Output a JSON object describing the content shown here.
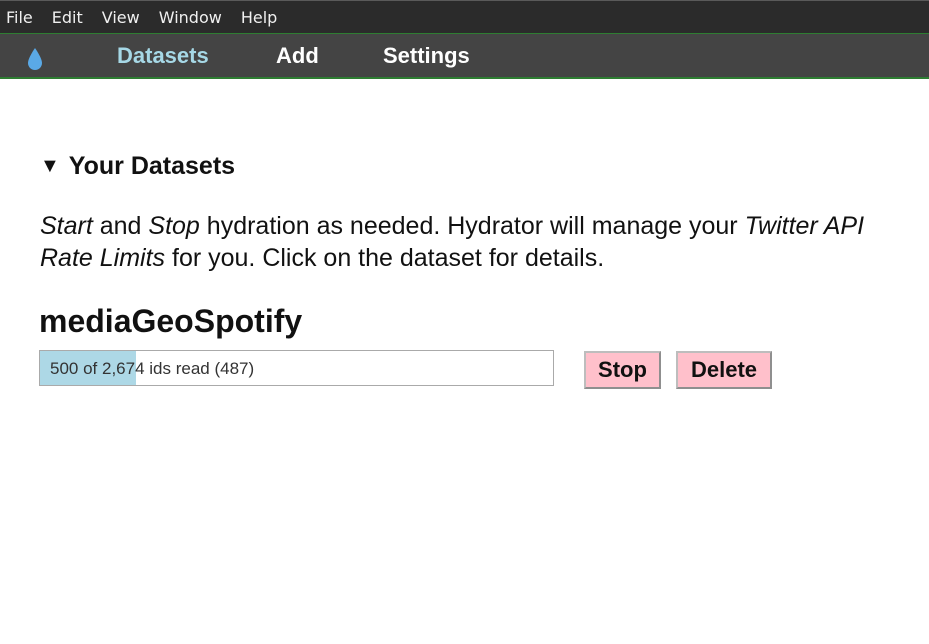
{
  "menubar": {
    "items": [
      "File",
      "Edit",
      "View",
      "Window",
      "Help"
    ]
  },
  "nav": {
    "logo_icon": "water-drop-icon",
    "logo_color": "#5aa9e6",
    "links": [
      {
        "label": "Datasets",
        "active": true
      },
      {
        "label": "Add",
        "active": false
      },
      {
        "label": "Settings",
        "active": false
      }
    ],
    "active_color": "#a6d8e6",
    "accent_border": "#2e7d32"
  },
  "section": {
    "toggle_icon": "▼",
    "title": "Your Datasets"
  },
  "intro": {
    "start": "Start",
    "and": " and ",
    "stop": "Stop",
    "middle": " hydration as needed. Hydrator will manage your ",
    "rate_limits": "Twitter API Rate Limits",
    "end": " for you. Click on the dataset for details."
  },
  "dataset": {
    "name": "mediaGeoSpotify",
    "progress_label": "500 of 2,674 ids read (487)",
    "progress_fraction": 0.187,
    "progress_color": "#add8e6",
    "stop_label": "Stop",
    "delete_label": "Delete",
    "button_color": "#ffc0cb"
  }
}
